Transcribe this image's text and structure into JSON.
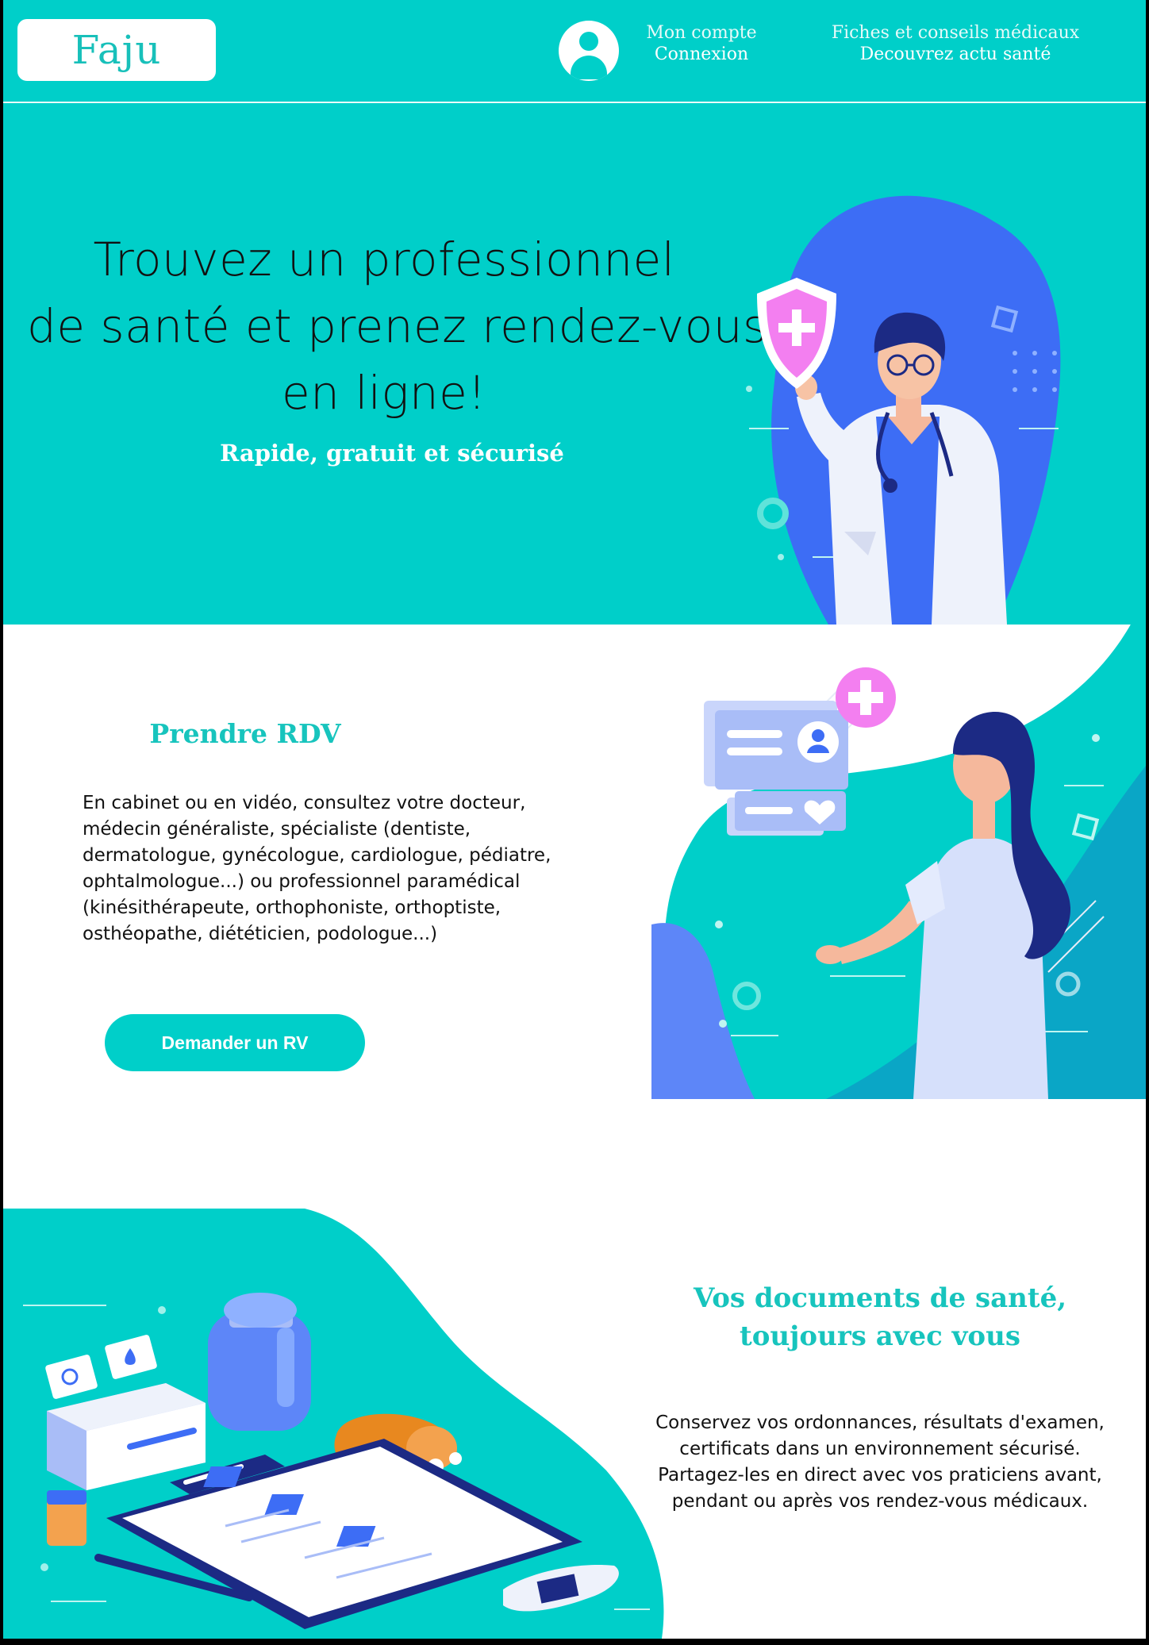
{
  "header": {
    "logo": "Faju",
    "account": {
      "line1": "Mon compte",
      "line2": "Connexion"
    },
    "health": {
      "line1": "Fiches et conseils médicaux",
      "line2": "Decouvrez actu santé"
    }
  },
  "hero": {
    "title_lines": [
      "Trouvez un professionnel",
      "de santé et prenez rendez-vous",
      "en ligne!"
    ],
    "subtitle": "Rapide, gratuit et sécurisé"
  },
  "appointment": {
    "title": "Prendre RDV",
    "text_lines": [
      "En cabinet ou en vidéo, consultez votre docteur,",
      "médecin généraliste, spécialiste (dentiste,",
      "dermatologue, gynécologue, cardiologue, pédiatre,",
      "ophtalmologue...) ou professionnel paramédical",
      "(kinésithérapeute, orthophoniste, orthoptiste,",
      "osthéopathe, diététicien, podologue...)"
    ],
    "button": "Demander un RV"
  },
  "documents": {
    "title_lines": [
      "Vos documents de santé,",
      "toujours avec vous"
    ],
    "text_lines": [
      "Conservez vos ordonnances, résultats d'examen,",
      "certificats dans un environnement sécurisé.",
      "Partagez-les en direct avec vos praticiens avant,",
      "pendant ou après vos rendez-vous médicaux."
    ]
  },
  "colors": {
    "brand": "#00cfc9",
    "brand_text": "#17c4bd",
    "accent_blue": "#3d6df5",
    "accent_pink": "#f37ff0"
  },
  "icons": [
    "user-avatar-icon",
    "shield-plus-icon",
    "medical-cross-icon",
    "heartbeat-icon",
    "user-card-icon"
  ]
}
